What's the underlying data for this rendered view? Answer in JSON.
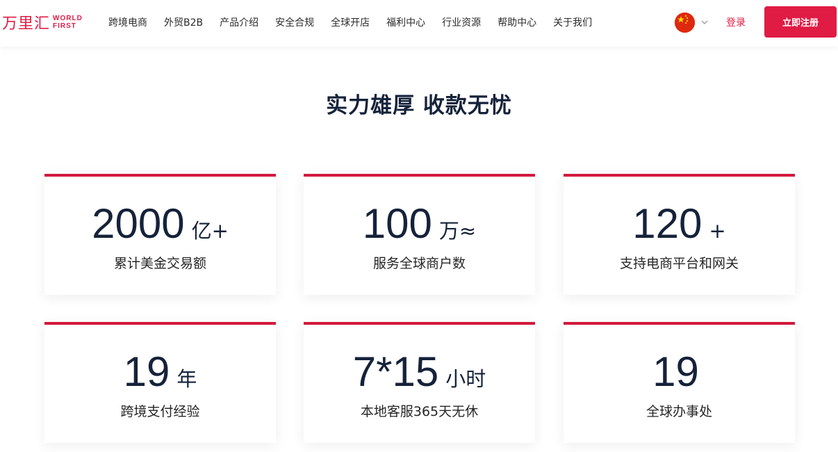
{
  "brand": {
    "name_cn": "万里汇",
    "name_en_line1": "WORLD",
    "name_en_line2": "FIRST",
    "accent_color": "#e01b44"
  },
  "nav": {
    "items": [
      {
        "label": "跨境电商"
      },
      {
        "label": "外贸B2B"
      },
      {
        "label": "产品介绍"
      },
      {
        "label": "安全合规"
      },
      {
        "label": "全球开店"
      },
      {
        "label": "福利中心"
      },
      {
        "label": "行业资源"
      },
      {
        "label": "帮助中心"
      },
      {
        "label": "关于我们"
      }
    ]
  },
  "header_actions": {
    "language_icon": "china-flag-icon",
    "login_label": "登录",
    "register_label": "立即注册"
  },
  "stats_section": {
    "title": "实力雄厚 收款无忧",
    "cards": [
      {
        "value": "2000",
        "unit": "亿+",
        "label": "累计美金交易额"
      },
      {
        "value": "100",
        "unit": "万≈",
        "label": "服务全球商户数"
      },
      {
        "value": "120",
        "unit": "+",
        "label": "支持电商平台和网关"
      },
      {
        "value": "19",
        "unit": "年",
        "label": "跨境支付经验"
      },
      {
        "value": "7*15",
        "unit": "小时",
        "label": "本地客服365天无休"
      },
      {
        "value": "19",
        "unit": "",
        "label": "全球办事处"
      }
    ]
  }
}
